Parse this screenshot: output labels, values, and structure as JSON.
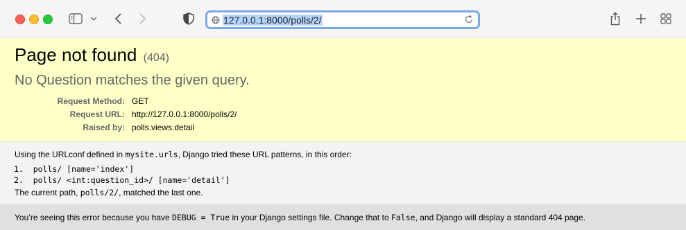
{
  "browser": {
    "url": "127.0.0.1:8000/polls/2/"
  },
  "page": {
    "title": "Page not found",
    "status_code": "(404)",
    "message": "No Question matches the given query.",
    "details": [
      {
        "label": "Request Method:",
        "value": "GET"
      },
      {
        "label": "Request URL:",
        "value": "http://127.0.0.1:8000/polls/2/"
      },
      {
        "label": "Raised by:",
        "value": "polls.views.detail"
      }
    ],
    "urlconf_prefix": "Using the URLconf defined in ",
    "urlconf_name": "mysite.urls",
    "urlconf_suffix": ", Django tried these URL patterns, in this order:",
    "patterns": [
      "1.  polls/ [name='index']",
      "2.  polls/ <int:question_id>/ [name='detail']"
    ],
    "current_prefix": "The current path, ",
    "current_path": "polls/2/",
    "current_suffix": ", matched the last one.",
    "explain_1": "You’re seeing this error because you have ",
    "explain_debug": "DEBUG = True",
    "explain_2": " in your Django settings file. Change that to ",
    "explain_false": "False",
    "explain_3": ", and Django will display a standard 404 page."
  },
  "colors": {
    "summary_bg": "#ffffc8",
    "info_bg": "#f3f3f3",
    "explain_bg": "#e0e0e0",
    "address_focus": "#7aa7ec"
  }
}
